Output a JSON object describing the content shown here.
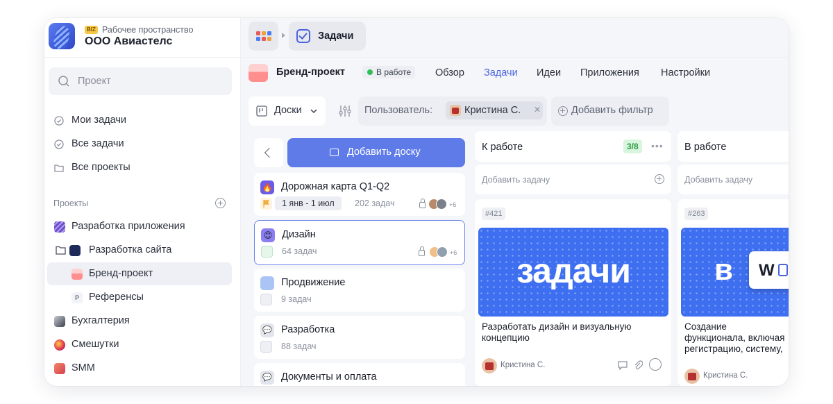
{
  "workspace": {
    "badge": "BIZ",
    "subtitle": "Рабочее пространство",
    "name": "ООО Авиастелс"
  },
  "search": {
    "placeholder": "Проект"
  },
  "nav": {
    "items": [
      {
        "label": "Мои задачи"
      },
      {
        "label": "Все задачи"
      },
      {
        "label": "Все проекты"
      }
    ]
  },
  "projects": {
    "section_label": "Проекты",
    "items": [
      {
        "label": "Разработка приложения",
        "color": "#6a4fc8"
      },
      {
        "label": "Разработка сайта",
        "color": "#3e6ff0"
      },
      {
        "label": "Бренд-проект",
        "color": "#ff8f8f"
      },
      {
        "label": "Референсы",
        "icon_letter": "P"
      },
      {
        "label": "Бухгалтерия",
        "color": "#2b303c"
      },
      {
        "label": "Смешутки",
        "color": "#d8304a"
      },
      {
        "label": "SMM",
        "color": "#e05b5b"
      }
    ]
  },
  "topbar": {
    "tab_label": "Задачи"
  },
  "project": {
    "name": "Бренд-проект",
    "status": "В работе",
    "status_color": "#2fbf55",
    "tabs": [
      {
        "label": "Обзор"
      },
      {
        "label": "Задачи",
        "active": true
      },
      {
        "label": "Идеи"
      },
      {
        "label": "Приложения"
      },
      {
        "label": "Настройки"
      }
    ]
  },
  "filters": {
    "boards_label": "Доски",
    "user_label": "Пользователь:",
    "user_value": "Кристина С.",
    "add_filter": "Добавить фильтр"
  },
  "boards": {
    "add_label": "Добавить доску",
    "items": [
      {
        "title": "Дорожная карта Q1-Q2",
        "date_range": "1 янв - 1 июл",
        "count": "202 задач",
        "more": "+6",
        "icon": "🔥"
      },
      {
        "title": "Дизайн",
        "count": "64 задач",
        "more": "+6",
        "icon": "😊"
      },
      {
        "title": "Продвижение",
        "count": "9 задач"
      },
      {
        "title": "Разработка",
        "count": "88 задач",
        "icon": "💬"
      },
      {
        "title": "Документы и оплата",
        "icon": "💬"
      }
    ]
  },
  "columns": [
    {
      "title": "К работе",
      "badge": "3/8",
      "add_task": "Добавить задачу",
      "card": {
        "number": "#421",
        "cover_text": "задачи",
        "title": "Разработать дизайн и визуальную концепцию",
        "assignee": "Кристина С."
      }
    },
    {
      "title": "В работе",
      "add_task": "Добавить задачу",
      "card": {
        "number": "#263",
        "cover_text": "в",
        "cover_chip": "W",
        "title": "Создание функционала, включая регистрацию, систему, формы обратной связи",
        "assignee": "Кристина С."
      }
    }
  ],
  "colors": {
    "accent": "#4a63e0",
    "button": "#5e7be8",
    "cover": "#3e6ff0",
    "badge_green": "#2b9a45"
  }
}
